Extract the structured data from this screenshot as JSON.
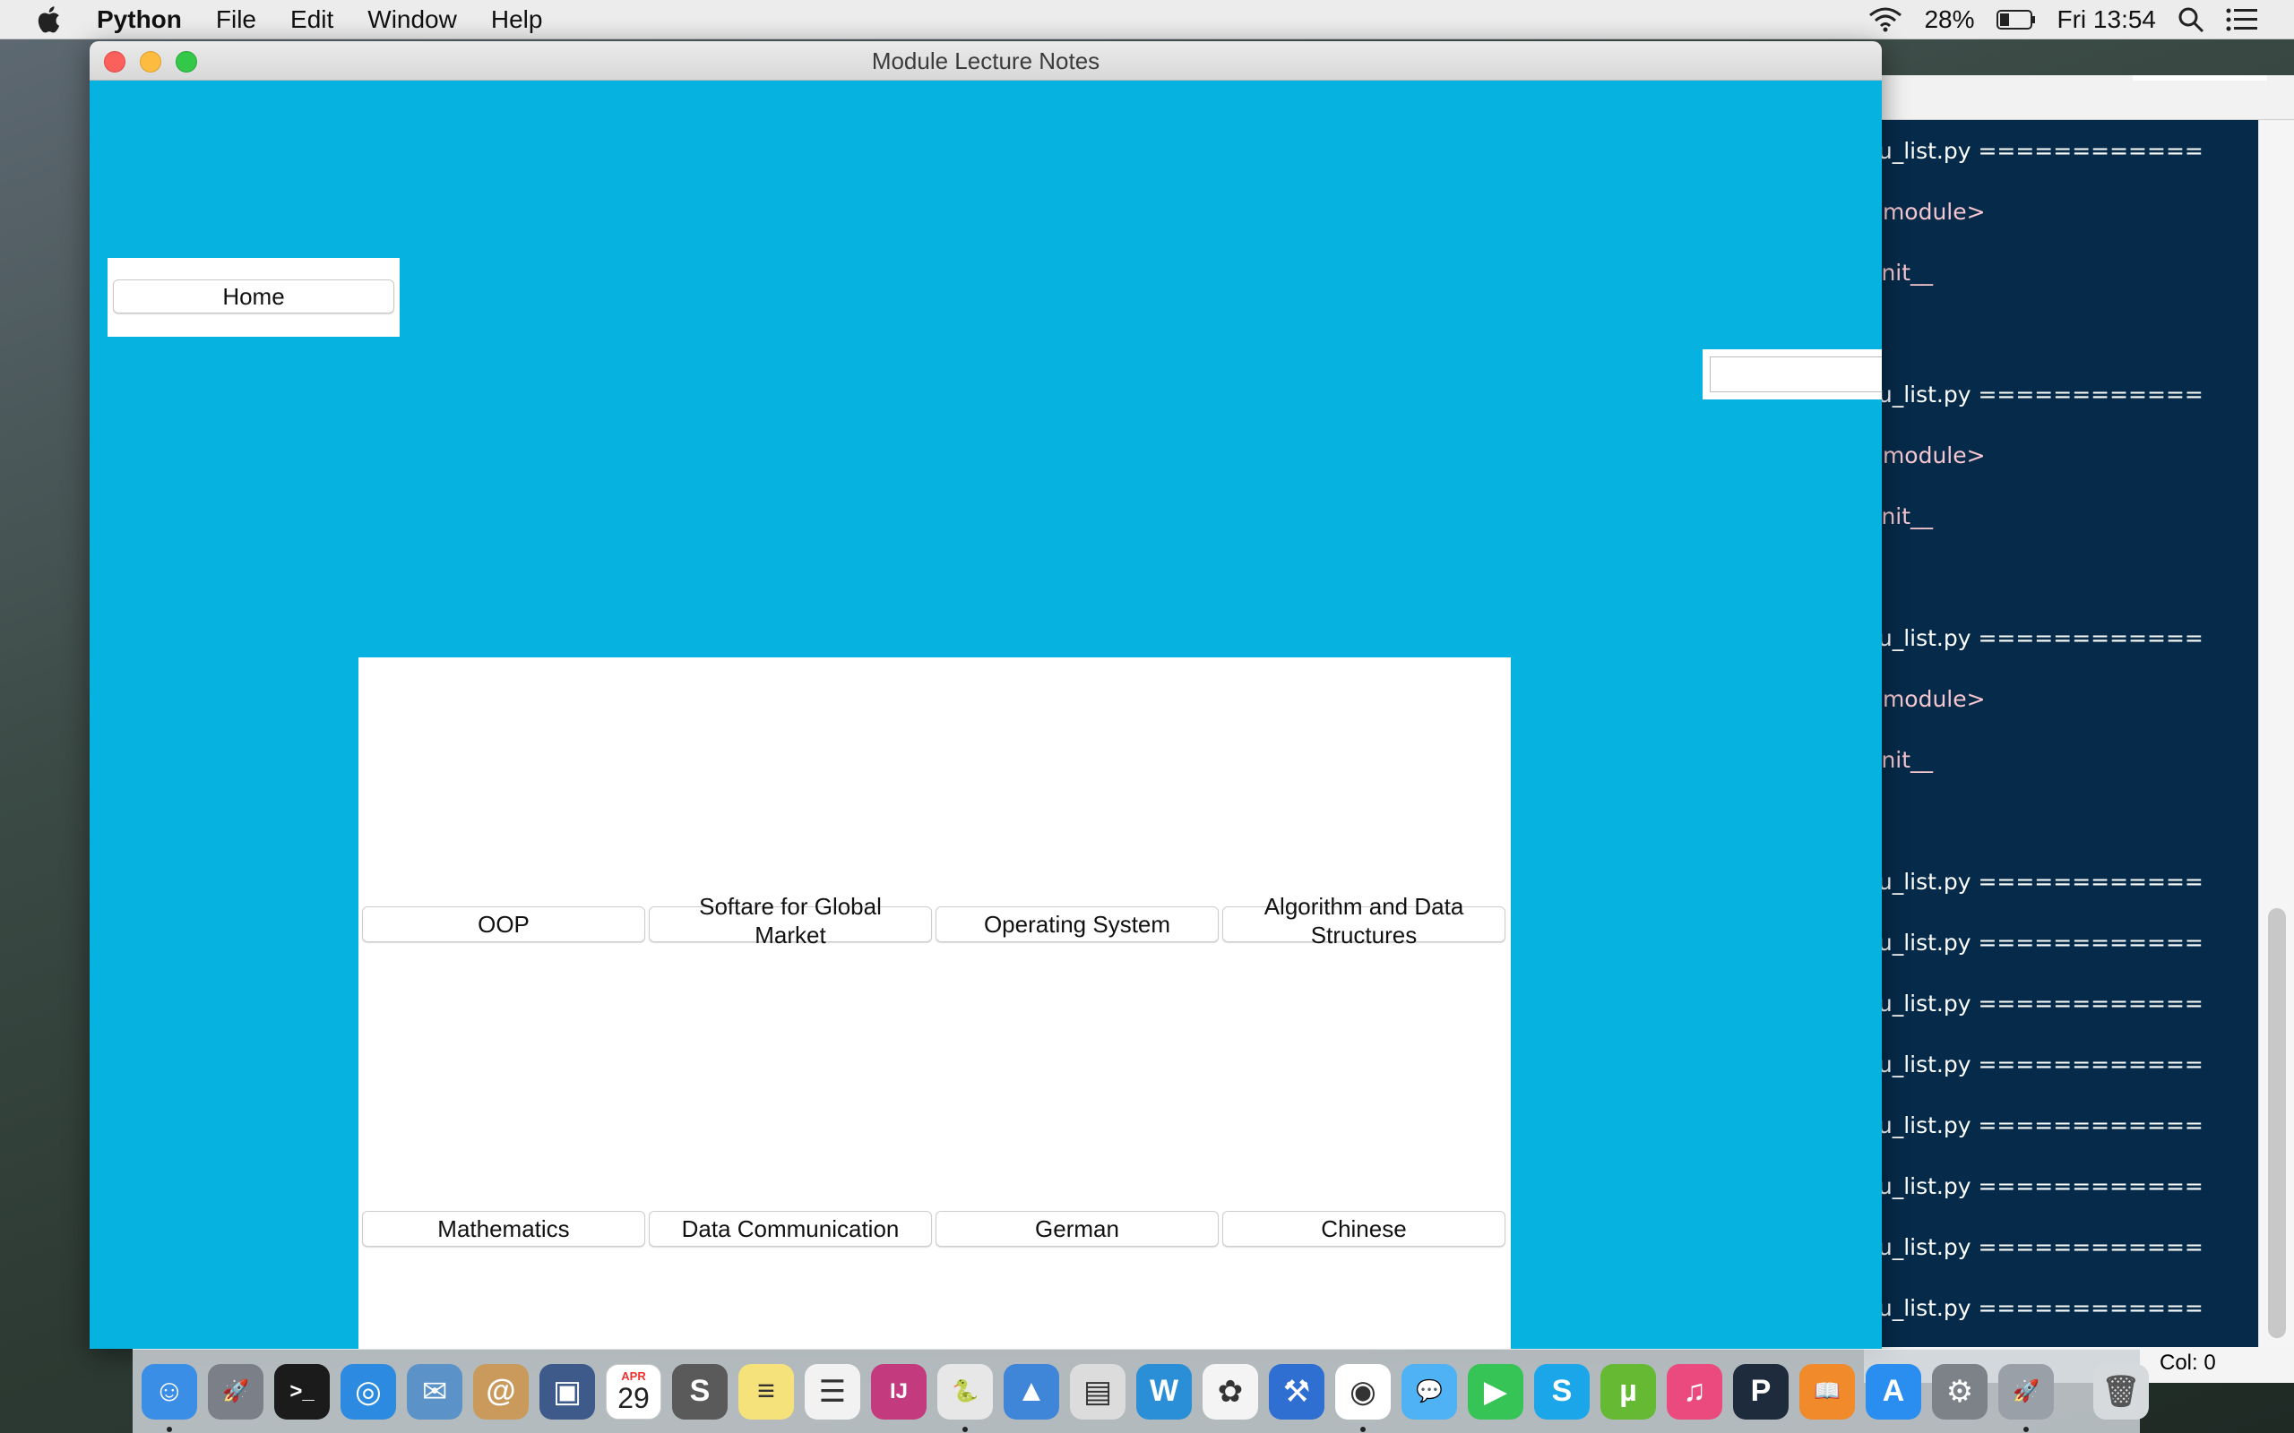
{
  "menubar": {
    "app_name": "Python",
    "items": [
      "File",
      "Edit",
      "Window",
      "Help"
    ],
    "battery": "28%",
    "clock": "Fri 13:54"
  },
  "background_window": {
    "lines": [
      {
        "text": "nu_list.py ============",
        "color": "white"
      },
      {
        "text": "<module>",
        "color": "pink"
      },
      {
        "text": "_init__",
        "color": "pink"
      },
      {
        "text": "nu_list.py ============",
        "color": "white"
      },
      {
        "text": "<module>",
        "color": "pink"
      },
      {
        "text": "_init__",
        "color": "pink"
      },
      {
        "text": "nu_list.py ============",
        "color": "white"
      },
      {
        "text": "<module>",
        "color": "pink"
      },
      {
        "text": "_init__",
        "color": "pink"
      },
      {
        "text": "nu_list.py ============",
        "color": "white"
      },
      {
        "text": "nu_list.py ============",
        "color": "white"
      },
      {
        "text": "nu_list.py ============",
        "color": "white"
      },
      {
        "text": "nu_list.py ============",
        "color": "white"
      },
      {
        "text": "nu_list.py ============",
        "color": "white"
      },
      {
        "text": "nu_list.py ============",
        "color": "white"
      },
      {
        "text": "nu_list.py ============",
        "color": "white"
      },
      {
        "text": "nu_list.py ============",
        "color": "white"
      }
    ],
    "status": "Col: 0"
  },
  "main_window": {
    "title": "Module Lecture Notes",
    "home_label": "Home",
    "entry_value": "",
    "modules_row1": [
      "OOP",
      "Softare for Global Market",
      "Operating System",
      "Algorithm and Data Structures"
    ],
    "modules_row2": [
      "Mathematics",
      "Data Communication",
      "German",
      "Chinese"
    ],
    "background_color": "#06b2df"
  },
  "dock": {
    "calendar_month": "APR",
    "calendar_day": "29",
    "apps": [
      {
        "name": "finder",
        "color": "#3a8ee6",
        "glyph": "☺",
        "running": true
      },
      {
        "name": "launchpad",
        "color": "#7a7f88",
        "glyph": "🚀",
        "running": false
      },
      {
        "name": "terminal",
        "color": "#1b1b1b",
        "glyph": ">_",
        "running": false
      },
      {
        "name": "safari",
        "color": "#2c8be0",
        "glyph": "◎",
        "running": false
      },
      {
        "name": "mail",
        "color": "#5b93c9",
        "glyph": "✉",
        "running": false
      },
      {
        "name": "contacts",
        "color": "#c99a5b",
        "glyph": "@",
        "running": false
      },
      {
        "name": "virtualbox",
        "color": "#3d5a8a",
        "glyph": "▣",
        "running": false
      },
      {
        "name": "calendar",
        "color": "#ffffff",
        "glyph": "",
        "running": false
      },
      {
        "name": "sublime-text",
        "color": "#5a5a5a",
        "glyph": "S",
        "running": false
      },
      {
        "name": "notes",
        "color": "#f5e27a",
        "glyph": "≡",
        "running": false
      },
      {
        "name": "reminders",
        "color": "#f2f2f2",
        "glyph": "☰",
        "running": false
      },
      {
        "name": "intellij-idea",
        "color": "#c33b7e",
        "glyph": "IJ",
        "running": false
      },
      {
        "name": "python-launcher",
        "color": "#e7e7e7",
        "glyph": "🐍",
        "running": true
      },
      {
        "name": "keynote",
        "color": "#3f86d9",
        "glyph": "▲",
        "running": false
      },
      {
        "name": "preview",
        "color": "#dcdcdc",
        "glyph": "▤",
        "running": false
      },
      {
        "name": "wiresharkish",
        "color": "#2a8fd6",
        "glyph": "W",
        "running": false
      },
      {
        "name": "photos",
        "color": "#f4f4f4",
        "glyph": "✿",
        "running": false
      },
      {
        "name": "xcode",
        "color": "#2f6fd1",
        "glyph": "⚒",
        "running": false
      },
      {
        "name": "chrome",
        "color": "#ffffff",
        "glyph": "◉",
        "running": true
      },
      {
        "name": "messages",
        "color": "#4fb2f5",
        "glyph": "💬",
        "running": false
      },
      {
        "name": "facetime",
        "color": "#36c457",
        "glyph": "▶",
        "running": false
      },
      {
        "name": "skype",
        "color": "#1aa6e8",
        "glyph": "S",
        "running": false
      },
      {
        "name": "utorrent",
        "color": "#66b933",
        "glyph": "µ",
        "running": false
      },
      {
        "name": "itunes",
        "color": "#ea4a7e",
        "glyph": "♫",
        "running": false
      },
      {
        "name": "pycharm-p",
        "color": "#1d2b3c",
        "glyph": "P",
        "running": false
      },
      {
        "name": "ibooks",
        "color": "#f08a2a",
        "glyph": "📖",
        "running": false
      },
      {
        "name": "app-store",
        "color": "#2a8ef0",
        "glyph": "A",
        "running": false
      },
      {
        "name": "system-preferences",
        "color": "#7d8288",
        "glyph": "⚙",
        "running": false
      },
      {
        "name": "rocket-app",
        "color": "#9aa0a8",
        "glyph": "🚀",
        "running": true
      }
    ],
    "trash": {
      "name": "trash",
      "color": "#d7dadd",
      "glyph": "🗑"
    }
  }
}
